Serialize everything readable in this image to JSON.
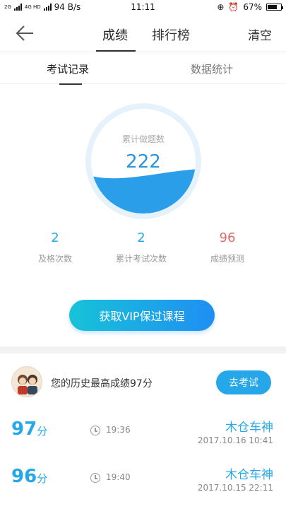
{
  "status_bar": {
    "signal_label_1": "2G",
    "signal_label_2": "4G HD",
    "network_speed": "94 B/s",
    "time": "11:11",
    "battery": "67%"
  },
  "nav": {
    "tabs": [
      "成绩",
      "排行榜"
    ],
    "clear_label": "清空"
  },
  "sub_tabs": [
    "考试记录",
    "数据统计"
  ],
  "gauge": {
    "label": "累计做题数",
    "value": "222",
    "fill_fraction": 0.38
  },
  "stats": [
    {
      "value": "2",
      "label": "及格次数",
      "color": "#26a7ea"
    },
    {
      "value": "2",
      "label": "累计考试次数",
      "color": "#26a7ea"
    },
    {
      "value": "96",
      "label": "成绩预测",
      "color": "#e06a6a"
    }
  ],
  "vip_button": "获取VIP保过课程",
  "best": {
    "text": "您的历史最高成绩97分",
    "button": "去考试"
  },
  "records": [
    {
      "score": "97",
      "unit": "分",
      "duration": "19:36",
      "name": "木仓车神",
      "date": "2017.10.16  10:41"
    },
    {
      "score": "96",
      "unit": "分",
      "duration": "19:40",
      "name": "木仓车神",
      "date": "2017.10.15  22:11"
    }
  ],
  "colors": {
    "accent": "#26a7ea",
    "wave": "#2a9ee8",
    "predict": "#e06a6a"
  }
}
